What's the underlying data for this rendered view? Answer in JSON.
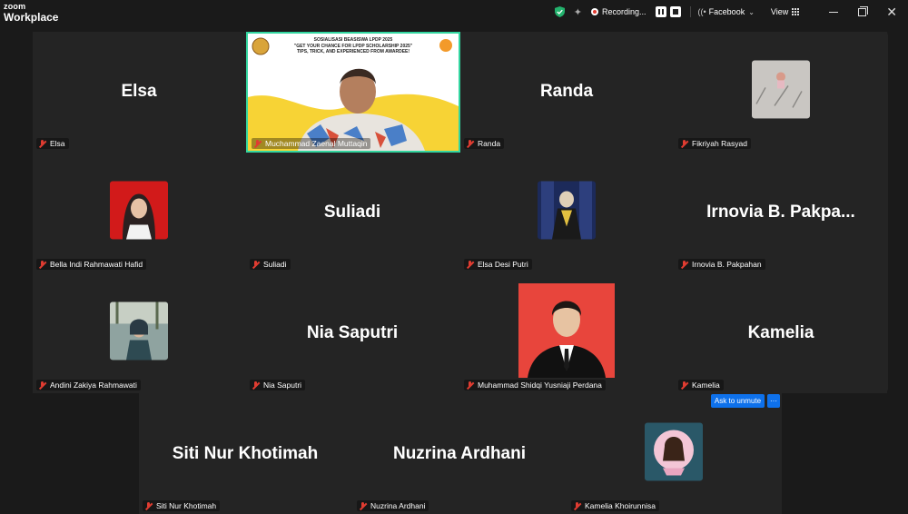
{
  "app": {
    "logo_line1": "zoom",
    "logo_line2": "Workplace"
  },
  "topbar": {
    "recording_label": "Recording...",
    "stream_label": "Facebook",
    "view_label": "View"
  },
  "video_banner": {
    "line1": "SOSIALISASI BEASISWA LPDP 2025",
    "line2": "\"GET YOUR CHANCE FOR LPDP SCHOLARSHIP 2025\"",
    "line3": "TIPS, TRICK, AND EXPERIENCED FROM AWARDEE!"
  },
  "participants": [
    {
      "display": "Elsa",
      "label": "Elsa",
      "type": "name"
    },
    {
      "display": "",
      "label": "Muchammad Zaenal Muttaqin",
      "type": "video"
    },
    {
      "display": "Randa",
      "label": "Randa",
      "type": "name"
    },
    {
      "display": "",
      "label": "Fikriyah Rasyad",
      "type": "avatar"
    },
    {
      "display": "",
      "label": "Bella Indi Rahmawati Hafid",
      "type": "avatar"
    },
    {
      "display": "Suliadi",
      "label": "Suliadi",
      "type": "name"
    },
    {
      "display": "",
      "label": "Elsa Desi Putri",
      "type": "avatar"
    },
    {
      "display": "Irnovia B. Pakpa...",
      "label": "Irnovia B. Pakpahan",
      "type": "name"
    },
    {
      "display": "",
      "label": "Andini Zakiya Rahmawati",
      "type": "avatar"
    },
    {
      "display": "Nia Saputri",
      "label": "Nia Saputri",
      "type": "name"
    },
    {
      "display": "",
      "label": "Muhammad Shidqi Yusniaji Perdana",
      "type": "avatar-large"
    },
    {
      "display": "Kamelia",
      "label": "Kamelia",
      "type": "name"
    },
    {
      "display": "Siti Nur Khotimah",
      "label": "Siti Nur Khotimah",
      "type": "name"
    },
    {
      "display": "Nuzrina Ardhani",
      "label": "Nuzrina Ardhani",
      "type": "name"
    },
    {
      "display": "",
      "label": "Kamelia Khoirunnisa",
      "type": "avatar"
    }
  ],
  "actions": {
    "ask_to_unmute": "Ask to unmute",
    "more": "···"
  },
  "colors": {
    "active_speaker_border": "#33d6a0",
    "button_blue": "#0e71eb",
    "muted_red": "#e03c31"
  }
}
